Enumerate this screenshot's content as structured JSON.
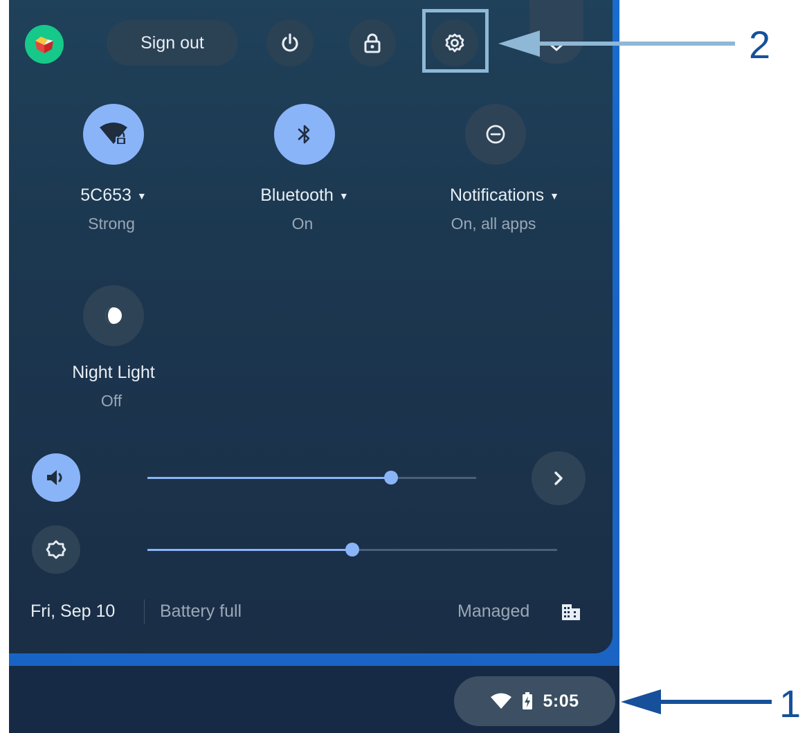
{
  "top_bar": {
    "sign_out_label": "Sign out",
    "avatar_icon": "avatar-icon",
    "power_icon": "power-icon",
    "lock_icon": "lock-icon",
    "settings_icon": "gear-icon",
    "collapse_icon": "chevron-down-icon"
  },
  "pods": [
    {
      "label": "5C653",
      "sublabel": "Strong",
      "icon": "wifi-locked-icon",
      "state": "on"
    },
    {
      "label": "Bluetooth",
      "sublabel": "On",
      "icon": "bluetooth-icon",
      "state": "on"
    },
    {
      "label": "Notifications",
      "sublabel": "On, all apps",
      "icon": "do-not-disturb-icon",
      "state": "off"
    },
    {
      "label": "Night Light",
      "sublabel": "Off",
      "icon": "night-light-icon",
      "state": "off"
    }
  ],
  "sliders": {
    "volume": {
      "icon": "volume-icon",
      "level_fraction": 0.74
    },
    "brightness": {
      "icon": "brightness-icon",
      "level_fraction": 0.5
    }
  },
  "footer": {
    "date": "Fri, Sep 10",
    "battery": "Battery full",
    "managed": "Managed",
    "managed_icon": "building-icon"
  },
  "shelf": {
    "time": "5:05",
    "wifi_icon": "wifi-icon",
    "battery_icon": "battery-charging-icon"
  },
  "annotations": {
    "label_1": "1",
    "label_2": "2"
  },
  "colors": {
    "accent": "#8ab4f8",
    "panel": "#1c3750",
    "annotation": "#16509a",
    "highlight": "#8fb7d6"
  }
}
